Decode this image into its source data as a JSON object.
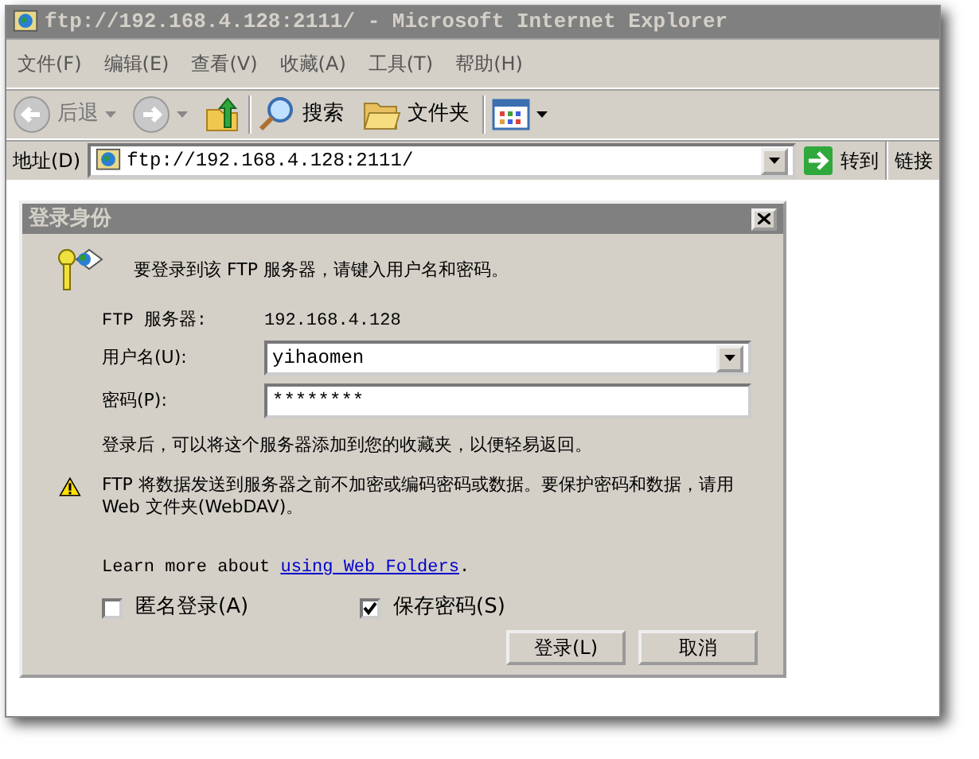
{
  "window": {
    "title": "ftp://192.168.4.128:2111/ - Microsoft Internet Explorer"
  },
  "menu": [
    "文件(F)",
    "编辑(E)",
    "查看(V)",
    "收藏(A)",
    "工具(T)",
    "帮助(H)"
  ],
  "toolbar": {
    "back": "后退",
    "search": "搜索",
    "folders": "文件夹"
  },
  "address_bar": {
    "label": "地址(D)",
    "value": "ftp://192.168.4.128:2111/",
    "go": "转到",
    "links": "链接"
  },
  "dialog": {
    "title": "登录身份",
    "prompt": "要登录到该 FTP 服务器，请键入用户名和密码。",
    "server_label": "FTP 服务器:",
    "server": "192.168.4.128",
    "username_label": "用户名(U):",
    "username": "yihaomen",
    "password_label": "密码(P):",
    "password": "********",
    "favorites_note": "登录后，可以将这个服务器添加到您的收藏夹，以便轻易返回。",
    "warning": "FTP 将数据发送到服务器之前不加密或编码密码或数据。要保护密码和数据，请用 Web 文件夹(WebDAV)。",
    "learn_more": "Learn more about ",
    "learn_more_link": "using Web Folders",
    "learn_more_end": ".",
    "checkboxes": [
      {
        "label": "匿名登录(A)",
        "checked": false
      },
      {
        "label": "保存密码(S)",
        "checked": true
      }
    ],
    "buttons": [
      "登录(L)",
      "取消"
    ]
  }
}
